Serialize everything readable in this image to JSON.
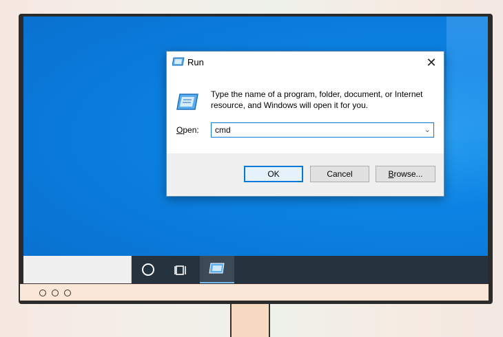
{
  "dialog": {
    "title": "Run",
    "description": "Type the name of a program, folder, document, or Internet resource, and Windows will open it for you.",
    "open_label_accel": "O",
    "open_label_rest": "pen:",
    "open_value": "cmd",
    "ok_label": "OK",
    "cancel_label": "Cancel",
    "browse_label_accel": "B",
    "browse_label_rest": "rowse...",
    "close_glyph": "✕",
    "dropdown_glyph": "⌄"
  },
  "colors": {
    "desktop": "#0c83e4",
    "taskbar": "#24333e",
    "accent": "#0078d7"
  },
  "icons": [
    "run-app-icon",
    "close-icon",
    "chevron-down-icon",
    "cortana-icon",
    "task-view-icon"
  ]
}
